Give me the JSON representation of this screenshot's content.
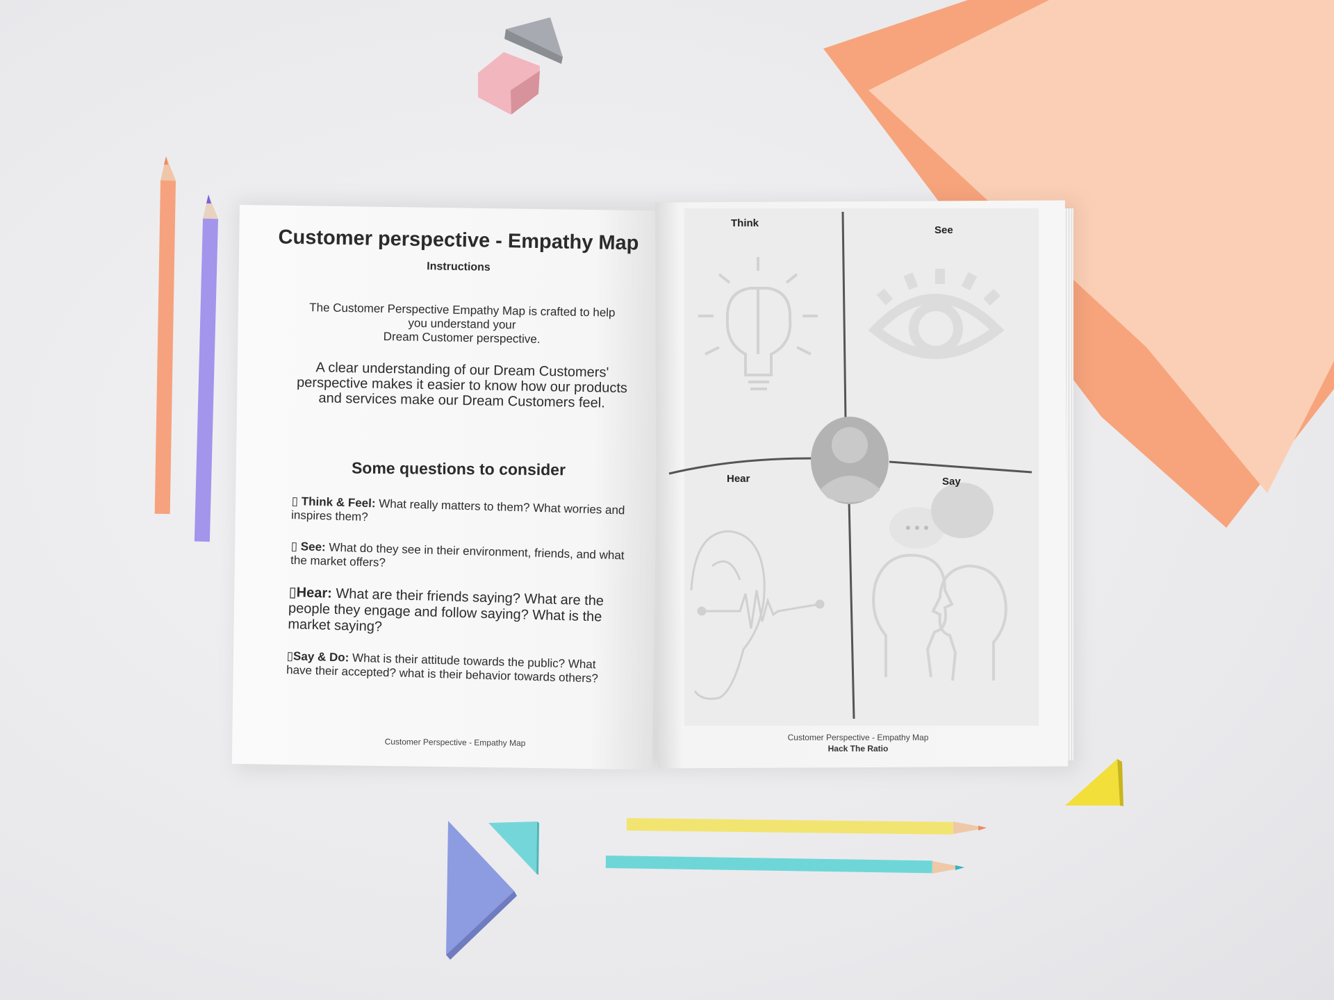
{
  "book": {
    "left_page": {
      "title": "Customer perspective - Empathy Map",
      "subtitle": "Instructions",
      "intro_line1": "The Customer Perspective Empathy Map is crafted to help",
      "intro_line2": "you understand your",
      "intro_line3": "Dream Customer perspective.",
      "intro2": "A clear understanding of our Dream Customers' perspective makes it easier to know how our products and services make our Dream Customers feel.",
      "questions_heading": "Some questions to consider",
      "questions": [
        {
          "bullet": "▯",
          "label": "Think & Feel:",
          "text": " What really matters to them? What worries and inspires them?"
        },
        {
          "bullet": "▯",
          "label": "See:",
          "text": " What do they see in their environment, friends, and what the market offers?"
        },
        {
          "bullet": "▯",
          "label": "Hear:",
          "text": " What are their friends saying? What are the people they engage and follow saying? What is the market saying?"
        },
        {
          "bullet": "▯",
          "label": "Say & Do:",
          "text": " What is their attitude towards the public? What have their accepted? what is their behavior towards others?"
        }
      ],
      "footer": "Customer Perspective - Empathy Map"
    },
    "right_page": {
      "quadrants": {
        "think": "Think",
        "see": "See",
        "hear": "Hear",
        "say": "Say"
      },
      "footer_line1": "Customer Perspective - Empathy Map",
      "footer_line2": "Hack The Ratio"
    }
  },
  "colors": {
    "orange_paper": "#f7a47c",
    "peach_paper": "#fbcfb5",
    "orange_pencil": "#f6a27e",
    "purple_pencil": "#a394ec",
    "yellow_pencil": "#f2e470",
    "teal_pencil": "#6fd6d8",
    "blue_shape": "#8d9be0",
    "teal_shape": "#75d6da",
    "yellow_shape": "#f2df3a",
    "pink_block": "#f2b6bf",
    "gray_block": "#b6b9be"
  }
}
